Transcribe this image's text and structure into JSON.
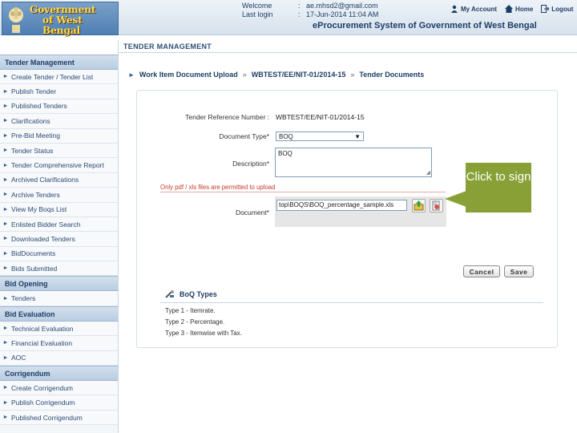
{
  "header": {
    "gov_line1": "Government",
    "gov_line2": "of West Bengal",
    "welcome_label": "Welcome",
    "welcome_value": "ae.mhsd2@gmail.com",
    "lastlogin_label": "Last login",
    "lastlogin_value": "17-Jun-2014 11:04 AM",
    "colon": ":",
    "links": {
      "account": "My Account",
      "home": "Home",
      "logout": "Logout"
    },
    "system_title": "eProcurement System of Government of West Bengal"
  },
  "subheader": "TENDER MANAGEMENT",
  "sidebar": {
    "sections": [
      {
        "title": "Tender Management",
        "items": [
          "Create Tender / Tender List",
          "Publish Tender",
          "Published Tenders",
          "Clarifications",
          "Pre-Bid Meeting",
          "Tender Status",
          "Tender Comprehensive Report",
          "Archived Clarifications",
          "Archive Tenders",
          "View My Boqs List",
          "Enlisted Bidder Search",
          "Downloaded Tenders",
          "BidDocuments",
          "Bids Submitted"
        ]
      },
      {
        "title": "Bid Opening",
        "items": [
          "Tenders"
        ]
      },
      {
        "title": "Bid Evaluation",
        "items": [
          "Technical Evaluation",
          "Financial Evaluation",
          "AOC"
        ]
      },
      {
        "title": "Corrigendum",
        "items": [
          "Create Corrigendum",
          "Publish Corrigendum",
          "Published Corrigendum"
        ]
      }
    ]
  },
  "breadcrumb": {
    "step1": "Work Item Document Upload",
    "sep": "»",
    "step2": "WBTEST/EE/NIT-01/2014-15",
    "step3": "Tender Documents"
  },
  "form": {
    "ref_label": "Tender Reference Number :",
    "ref_value": "WBTEST/EE/NIT-01/2014-15",
    "doctype_label": "Document Type*",
    "doctype_value": "BOQ",
    "desc_label": "Description*",
    "desc_value": "BOQ",
    "warning": "Only pdf / xls files are permitted to upload",
    "doc_label": "Document*",
    "doc_value": "top\\BOQS\\BOQ_percentage_sample.xls",
    "cancel_label": "Cancel",
    "save_label": "Save"
  },
  "tooltip": "Click to sign",
  "boq": {
    "title": "BoQ Types",
    "types": [
      "Type 1 - Itemrate.",
      "Type 2 - Percentage.",
      "Type 3 - Itemwise with Tax."
    ]
  },
  "colors": {
    "accent": "#1f3d66",
    "tooltip": "#88a035",
    "warning": "#c0392b"
  }
}
